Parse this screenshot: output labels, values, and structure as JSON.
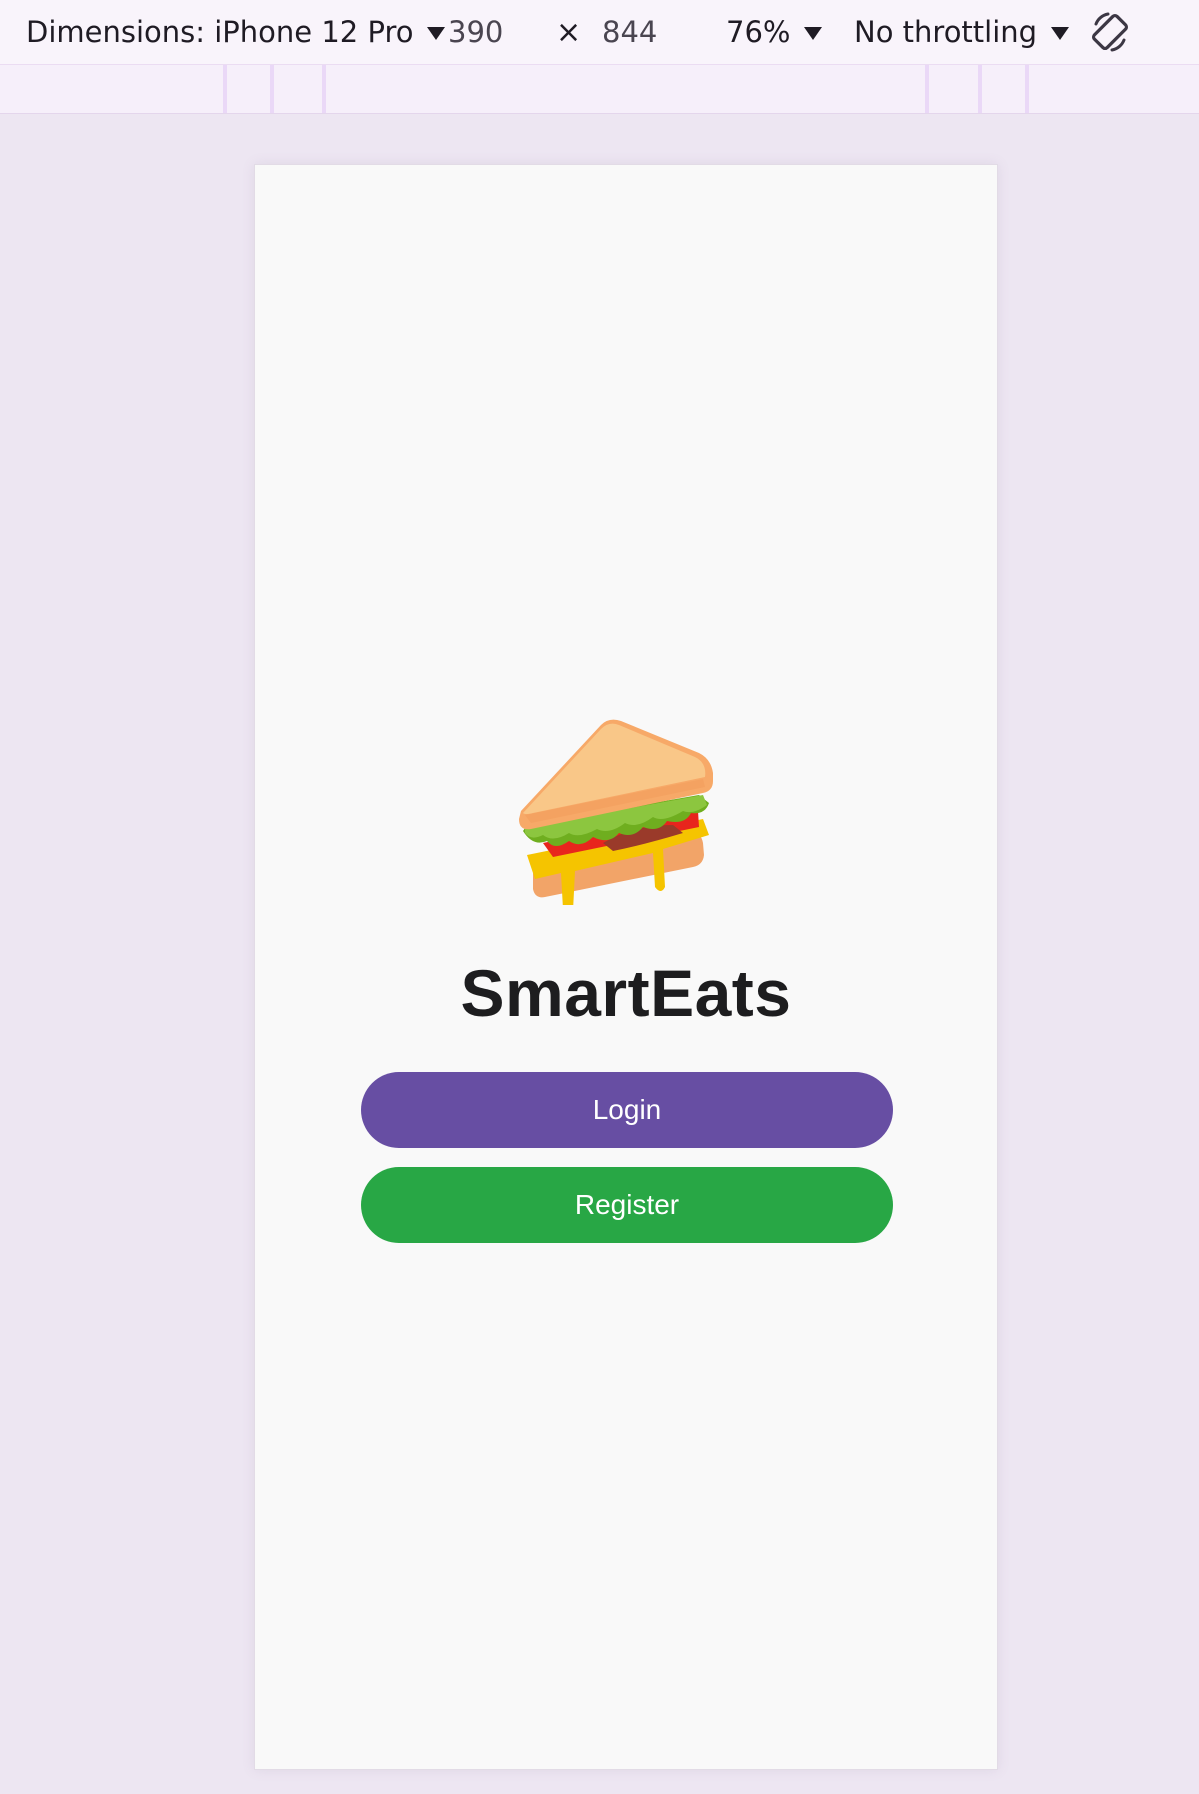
{
  "devtools": {
    "device_label": "Dimensions: iPhone 12 Pro",
    "width": "390",
    "times": "×",
    "height": "844",
    "zoom": "76%",
    "throttling": "No throttling",
    "rotate_icon": "rotate-device-icon"
  },
  "app": {
    "logo_icon": "sandwich-icon",
    "title": "SmartEats",
    "login_label": "Login",
    "register_label": "Register"
  },
  "colors": {
    "login_button": "#674ea3",
    "register_button": "#28a745",
    "background": "#ede6f2",
    "viewport": "#f9f9f9"
  }
}
